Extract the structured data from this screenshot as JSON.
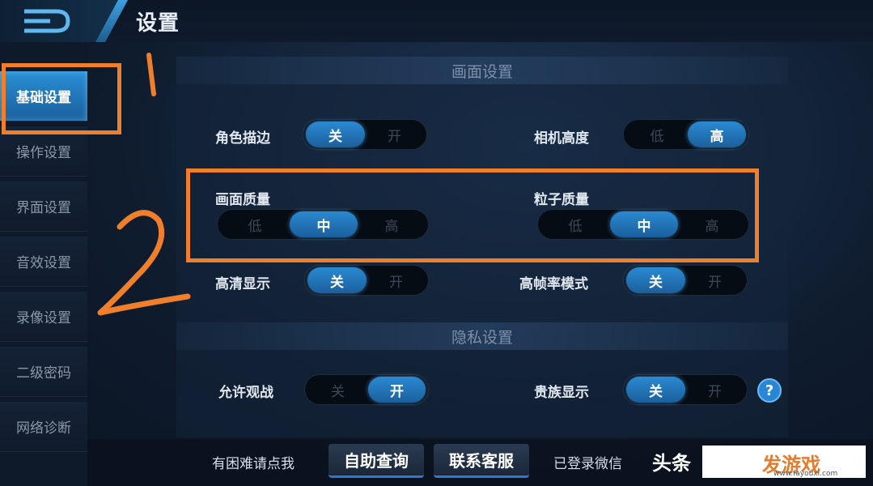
{
  "header": {
    "title": "设置"
  },
  "sidebar": {
    "items": [
      {
        "label": "基础设置",
        "active": true
      },
      {
        "label": "操作设置",
        "active": false
      },
      {
        "label": "界面设置",
        "active": false
      },
      {
        "label": "音效设置",
        "active": false
      },
      {
        "label": "录像设置",
        "active": false
      },
      {
        "label": "二级密码",
        "active": false
      },
      {
        "label": "网络诊断",
        "active": false
      }
    ]
  },
  "display_section": {
    "title": "画面设置",
    "role_outline": {
      "label": "角色描边",
      "options": [
        "关",
        "开"
      ],
      "selected": "关"
    },
    "camera_height": {
      "label": "相机高度",
      "options": [
        "低",
        "高"
      ],
      "selected": "高"
    },
    "image_quality": {
      "label": "画面质量",
      "options": [
        "低",
        "中",
        "高"
      ],
      "selected": "中"
    },
    "particle_quality": {
      "label": "粒子质量",
      "options": [
        "低",
        "中",
        "高"
      ],
      "selected": "中"
    },
    "hd_display": {
      "label": "高清显示",
      "options": [
        "关",
        "开"
      ],
      "selected": "关"
    },
    "high_fps": {
      "label": "高帧率模式",
      "options": [
        "关",
        "开"
      ],
      "selected": "关"
    }
  },
  "privacy_section": {
    "title": "隐私设置",
    "allow_spectate": {
      "label": "允许观战",
      "options": [
        "关",
        "开"
      ],
      "selected": "开"
    },
    "noble_display": {
      "label": "贵族显示",
      "options": [
        "关",
        "开"
      ],
      "selected": "关"
    },
    "help_icon": "?"
  },
  "footer": {
    "help_text": "有困难请点我",
    "self_service_button": "自助查询",
    "customer_service_button": "联系客服",
    "wechat_login_text": "已登录微信"
  },
  "watermark": {
    "left_text": "头条",
    "brand": "发游戏",
    "url": "www.fayouxi.com"
  },
  "annotations": {
    "mark1": "1",
    "mark2": "2",
    "color": "#f07f2b"
  },
  "colors": {
    "accent": "#2a8ad2",
    "annotation": "#f07f2b"
  }
}
